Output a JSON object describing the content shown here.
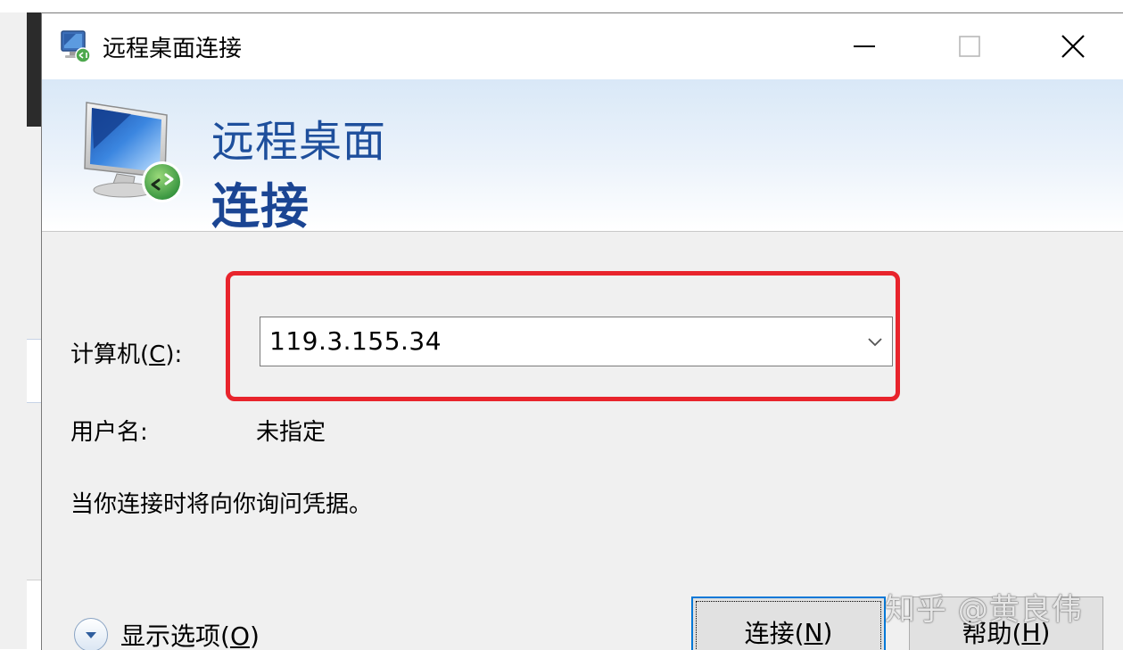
{
  "window": {
    "title": "远程桌面连接",
    "minimize_icon": "minimize-icon",
    "maximize_icon": "maximize-icon",
    "close_icon": "close-icon"
  },
  "banner": {
    "line1": "远程桌面",
    "line2": "连接",
    "icon": "remote-desktop-monitor-icon"
  },
  "form": {
    "computer_label_prefix": "计算机(",
    "computer_label_access": "C",
    "computer_label_suffix": "):",
    "computer_value": "119.3.155.34",
    "username_label": "用户名:",
    "username_value": "未指定",
    "info_text": "当你连接时将向你询问凭据。"
  },
  "footer": {
    "options_prefix": "显示选项(",
    "options_access": "O",
    "options_suffix": ")",
    "connect_prefix": "连接(",
    "connect_access": "N",
    "connect_suffix": ")",
    "help_prefix": "帮助(",
    "help_access": "H",
    "help_suffix": ")"
  },
  "watermark": "知乎 @黄良伟",
  "colors": {
    "highlight": "#e8242c",
    "banner_text": "#1e4f9c",
    "focus": "#0078d7"
  }
}
